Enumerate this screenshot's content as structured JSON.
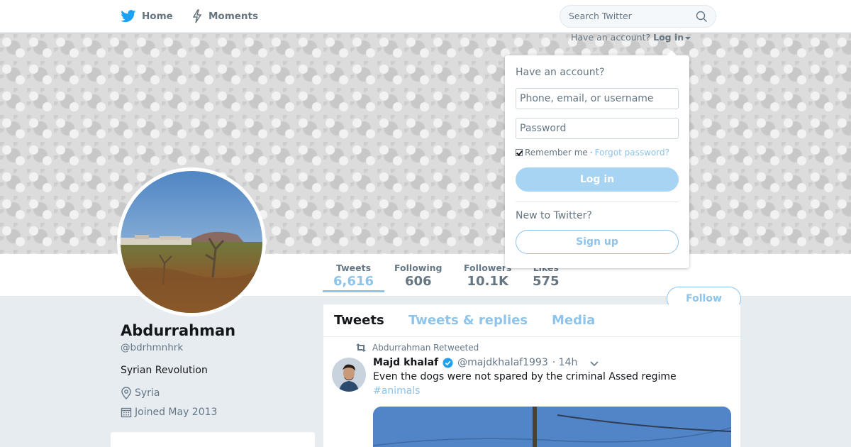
{
  "nav": {
    "home_label": "Home",
    "moments_label": "Moments",
    "search_placeholder": "Search Twitter"
  },
  "account_prompt": {
    "text": "Have an account?",
    "login_label": "Log in"
  },
  "login_dropdown": {
    "title": "Have an account?",
    "username_placeholder": "Phone, email, or username",
    "password_placeholder": "Password",
    "remember_label": "Remember me",
    "separator": "·",
    "forgot_label": "Forgot password?",
    "login_button": "Log in",
    "new_prompt": "New to Twitter?",
    "signup_button": "Sign up"
  },
  "stats": {
    "tweets_label": "Tweets",
    "tweets_value": "6,616",
    "following_label": "Following",
    "following_value": "606",
    "followers_label": "Followers",
    "followers_value": "10.1K",
    "likes_label": "Likes",
    "likes_value": "575"
  },
  "follow_button": "Follow",
  "profile": {
    "name": "Abdurrahman",
    "handle": "@bdrhmnhrk",
    "bio": "Syrian Revolution",
    "location": "Syria",
    "joined": "Joined May 2013"
  },
  "timeline": {
    "tabs": [
      "Tweets",
      "Tweets & replies",
      "Media"
    ],
    "tweet": {
      "retweet_context": "Abdurrahman Retweeted",
      "author_name": "Majd khalaf",
      "author_handle": "@majdkhalaf1993",
      "time": "· 14h",
      "text": "Even the dogs were not spared by the criminal Assed regime",
      "hashtag": "#animals"
    }
  },
  "colors": {
    "brand_blue": "#1da1f2",
    "accent_light_blue": "#8ec3ea",
    "muted_text": "#657786"
  },
  "icons": [
    "twitter-bird-icon",
    "moments-bolt-icon",
    "search-icon",
    "location-pin-icon",
    "calendar-icon",
    "retweet-icon",
    "verified-badge-icon",
    "chevron-down-icon"
  ]
}
